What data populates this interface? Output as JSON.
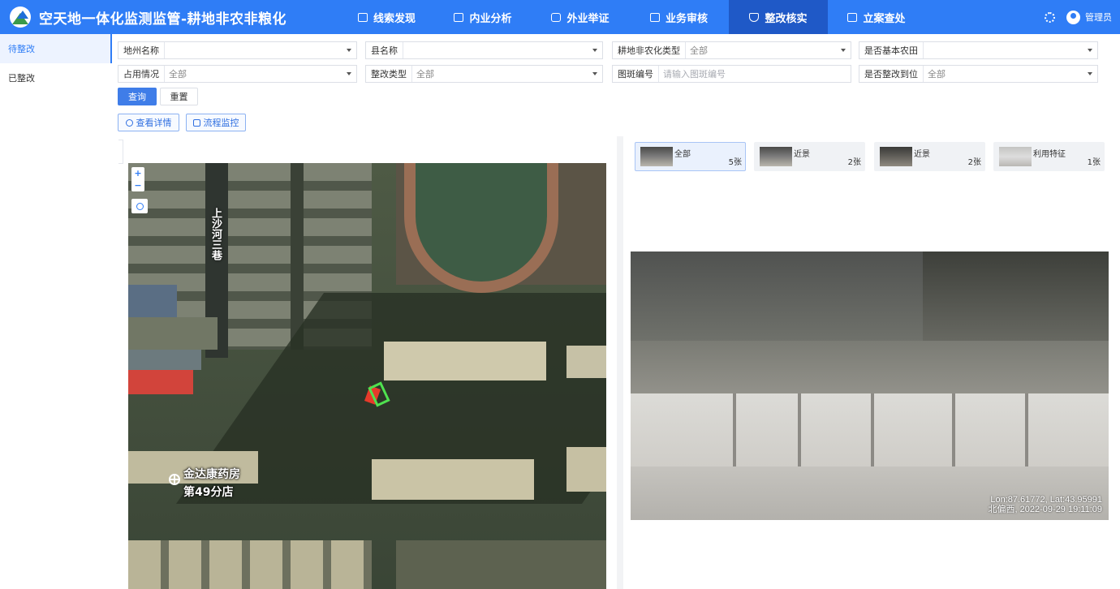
{
  "header": {
    "title": "空天地一体化监测监管-耕地非农非粮化",
    "nav": [
      {
        "label": "线索发现",
        "icon": "monitor-icon"
      },
      {
        "label": "内业分析",
        "icon": "document-icon"
      },
      {
        "label": "外业举证",
        "icon": "camera-icon"
      },
      {
        "label": "业务审核",
        "icon": "checklist-icon"
      },
      {
        "label": "整改核实",
        "icon": "shield-icon"
      },
      {
        "label": "立案查处",
        "icon": "file-icon"
      }
    ],
    "user": "管理员"
  },
  "sidebar": {
    "items": [
      {
        "label": "待整改"
      },
      {
        "label": "已整改"
      }
    ]
  },
  "filters": {
    "row1": [
      {
        "label": "地州名称",
        "value": ""
      },
      {
        "label": "县名称",
        "value": ""
      },
      {
        "label": "耕地非农化类型",
        "value": "全部"
      },
      {
        "label": "是否基本农田",
        "value": ""
      }
    ],
    "row2": [
      {
        "label": "占用情况",
        "value": "全部"
      },
      {
        "label": "整改类型",
        "value": "全部"
      },
      {
        "label": "图斑编号",
        "placeholder": "请输入图斑编号"
      },
      {
        "label": "是否整改到位",
        "value": "全部"
      }
    ]
  },
  "buttons": {
    "query": "查询",
    "reset": "重置",
    "view_details": "查看详情",
    "flow_monitor": "流程监控"
  },
  "map": {
    "zoom_in": "+",
    "zoom_out": "−",
    "road_label": "上沙河三巷",
    "poi_line1": "金达康药房",
    "poi_line2": "第49分店"
  },
  "photos": {
    "tabs": [
      {
        "label": "全部",
        "count": "5张"
      },
      {
        "label": "近景",
        "count": "2张"
      },
      {
        "label": "近景",
        "count": "2张"
      },
      {
        "label": "利用特征",
        "count": "1张"
      }
    ],
    "info_line1": "Lon:87.61772,  Lat:43.95991",
    "info_line2": "北偏西, 2022-09-29 19:11:09"
  }
}
